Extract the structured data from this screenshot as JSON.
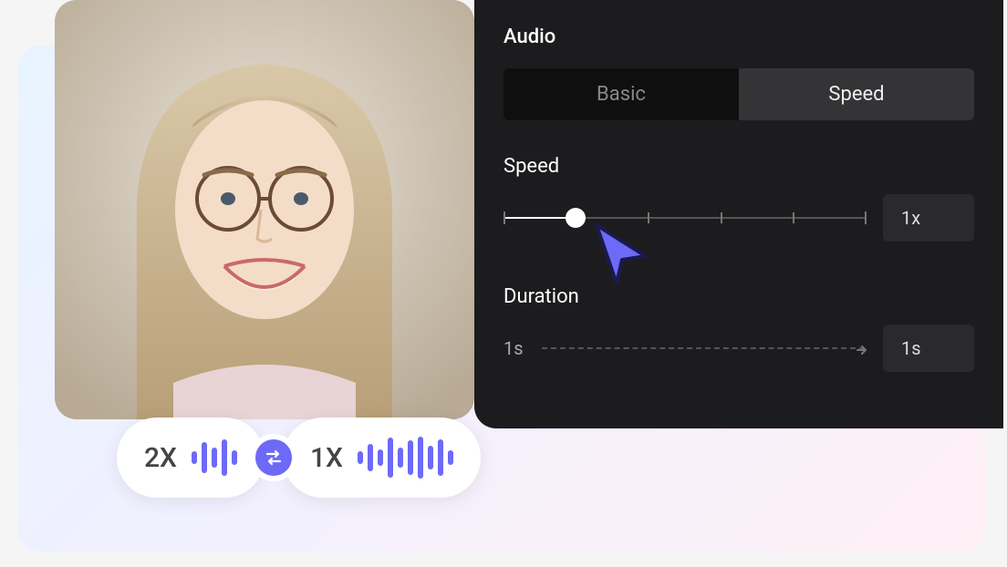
{
  "panel": {
    "title": "Audio",
    "tabs": {
      "basic": "Basic",
      "speed": "Speed",
      "active": "speed"
    },
    "speed": {
      "label": "Speed",
      "value": "1x",
      "slider_pct": 20
    },
    "duration": {
      "label": "Duration",
      "from": "1s",
      "to": "1s"
    }
  },
  "pills": {
    "left_label": "2X",
    "right_label": "1X"
  },
  "colors": {
    "accent": "#6d6af7",
    "panel_bg": "#1c1c1e"
  }
}
